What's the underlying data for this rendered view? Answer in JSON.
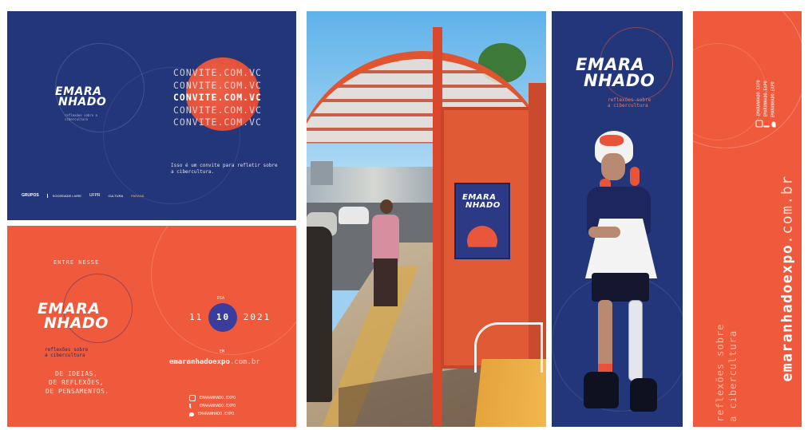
{
  "brand": {
    "line1": "EMARA",
    "line2": "NHADO",
    "tagline": "reflexões sobre a cibercultura",
    "tagline_top": "reflexões sobre",
    "tagline_bottom": "a cibercultura"
  },
  "colors": {
    "navy": "#24367a",
    "coral": "#ef5a3c",
    "sky": "#9fd0f2",
    "pavement": "#b7a58c",
    "wood": "#e6a33c"
  },
  "invite": {
    "lines": [
      "CONVITE.COM.VC",
      "CONVITE.COM.VC",
      "CONVITE.COM.VC",
      "CONVITE.COM.VC",
      "CONVITE.COM.VC"
    ],
    "body": "Isso é um convite para refletir sobre a cibercultura.",
    "sponsors": [
      "GRUPOS",
      "SOCIEDADE LIVRE",
      "UFPR",
      "CULTURA",
      "PARANÁ"
    ]
  },
  "coral_card": {
    "entre": "ENTRE NESSE",
    "ideas": [
      "DE IDEIAS,",
      "DE REFLEXÕES,",
      "DE PENSAMENTOS."
    ],
    "dia": "DIA",
    "date_day": "11",
    "date_month": "10",
    "date_year": "2021",
    "em": "EM",
    "url_bold": "emaranhadoexpo",
    "url_tail": ".com.br",
    "socials": [
      {
        "icon": "instagram-icon",
        "handle": "EMARANHADO.EXPO"
      },
      {
        "icon": "tiktok-icon",
        "handle": "EMARANHADO.EXPO"
      },
      {
        "icon": "twitter-icon",
        "handle": "EMARANHADO.EXPO"
      }
    ]
  },
  "bus_stop": {
    "poster_line1": "EMARA",
    "poster_line2": "NHADO"
  },
  "banner_coral": {
    "url_bold": "emaranhadoexpo",
    "url_tail": ".com.br",
    "tagline_top": "reflexões sobre",
    "tagline_bottom": "a cibercultura",
    "socials": [
      "EMARANHADO.EXPO",
      "EMARANHADO.EXPO",
      "EMARANHADO.EXPO"
    ]
  }
}
